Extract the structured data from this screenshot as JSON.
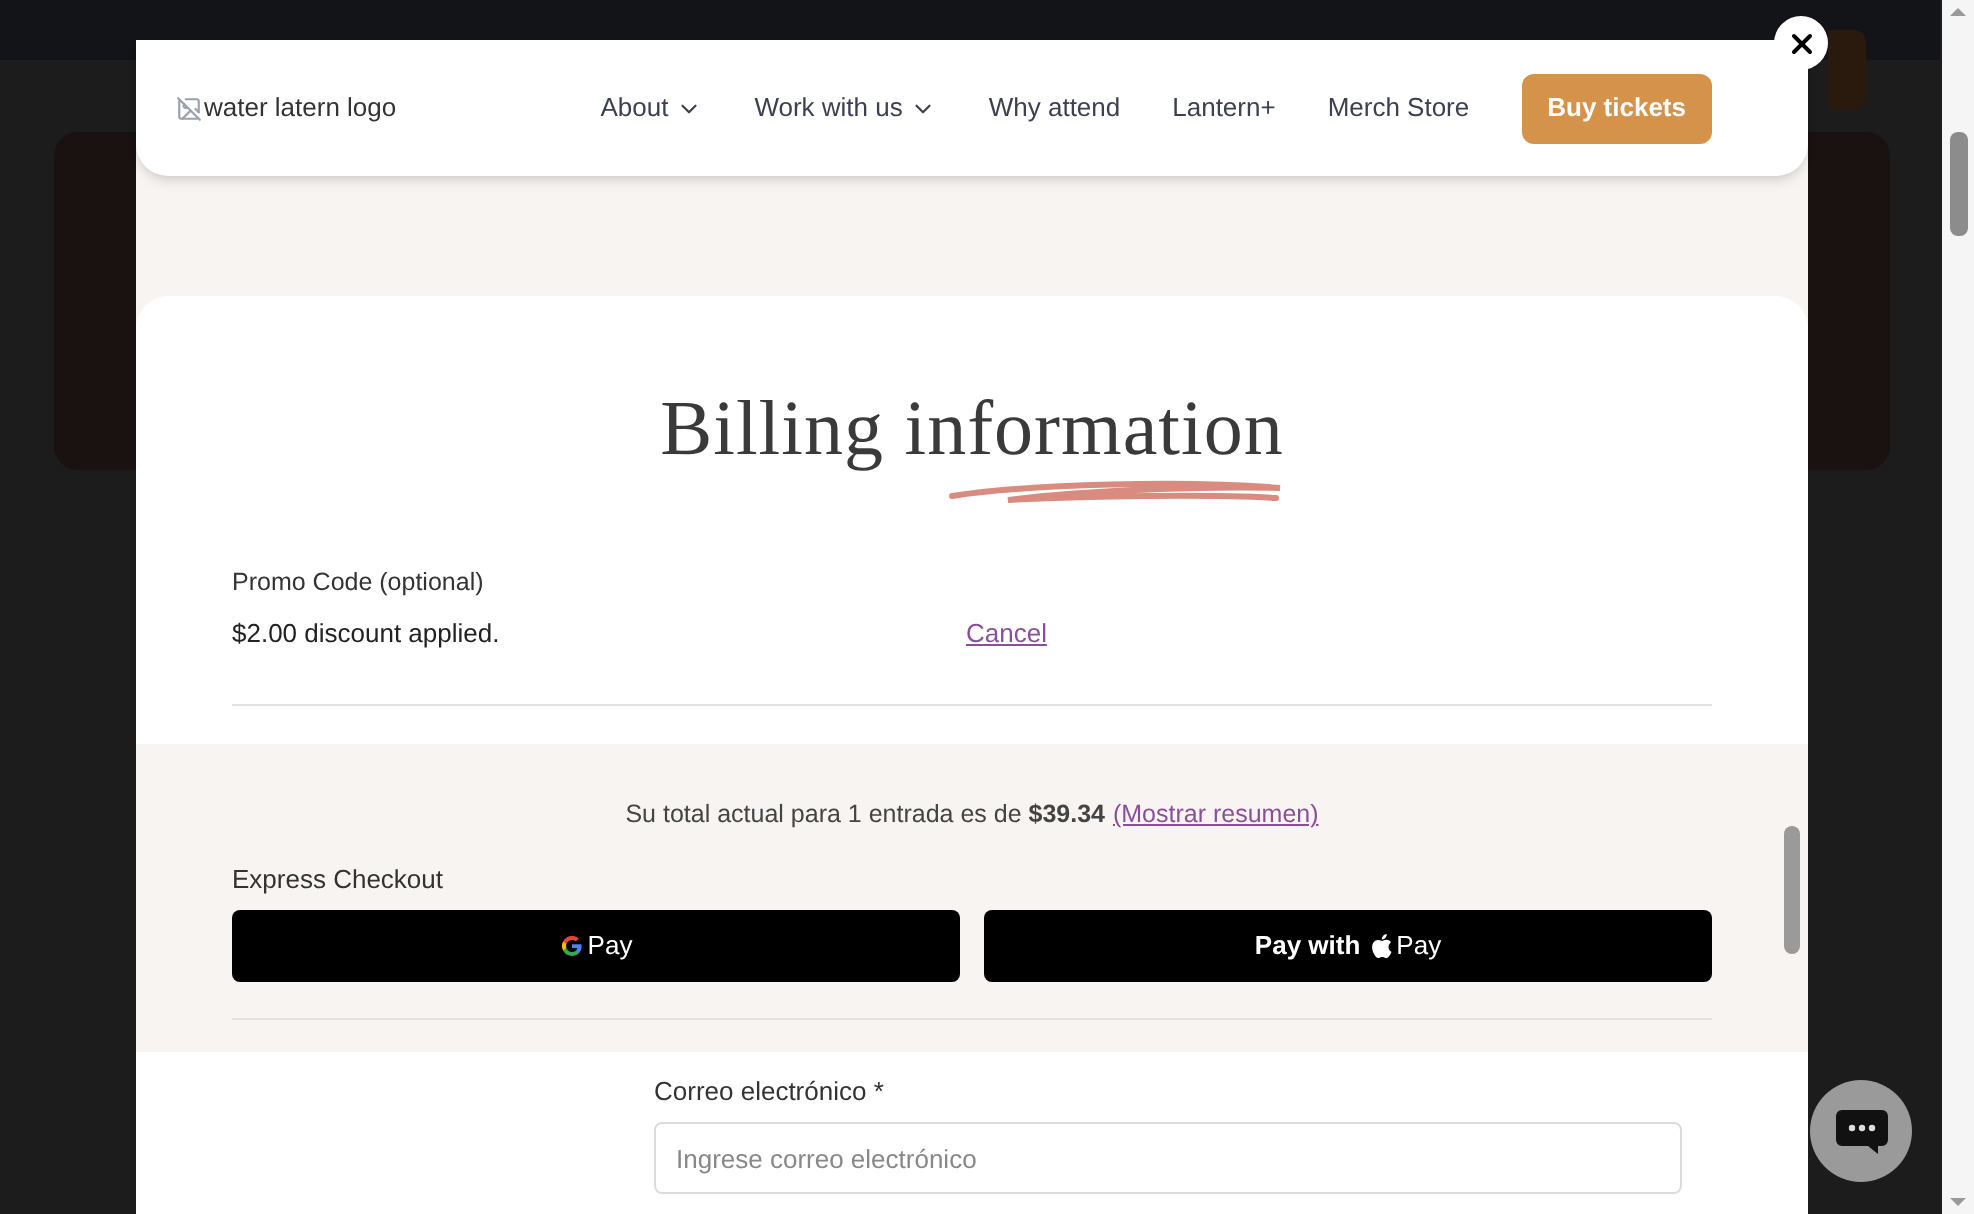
{
  "header": {
    "logo_alt": "water latern logo",
    "nav": [
      {
        "label": "About",
        "dropdown": true
      },
      {
        "label": "Work with us",
        "dropdown": true
      },
      {
        "label": "Why attend",
        "dropdown": false
      },
      {
        "label": "Lantern+",
        "dropdown": false
      },
      {
        "label": "Merch Store",
        "dropdown": false
      }
    ],
    "cta": "Buy tickets"
  },
  "billing": {
    "title": "Billing information",
    "promo": {
      "label": "Promo Code (optional)",
      "status": "$2.00 discount applied.",
      "cancel": "Cancel"
    },
    "total": {
      "text": "Su total actual para 1 entrada es de **$39.34**",
      "link": "(Mostrar resumen)"
    },
    "express": {
      "label": "Express Checkout",
      "buttons": [
        {
          "kind": "google",
          "label": "Pay"
        },
        {
          "kind": "apple",
          "label": "Pay with",
          "suffix": "Pay"
        }
      ]
    },
    "email": {
      "label": "Correo electrónico",
      "required_mark": "*",
      "placeholder": "Ingrese correo electrónico"
    }
  }
}
